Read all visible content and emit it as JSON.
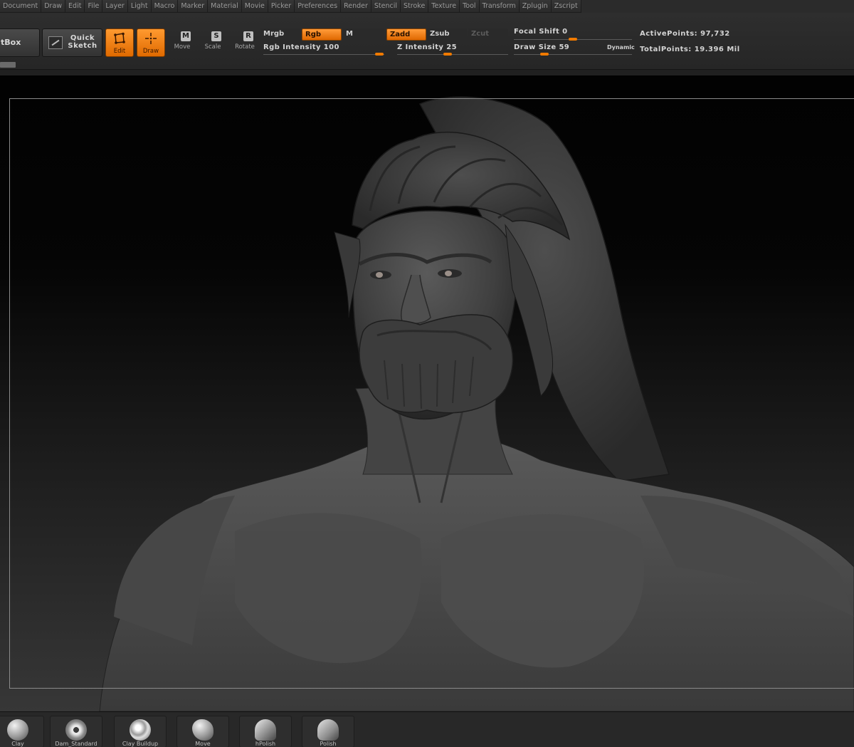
{
  "menu": [
    "Document",
    "Draw",
    "Edit",
    "File",
    "Layer",
    "Light",
    "Macro",
    "Marker",
    "Material",
    "Movie",
    "Picker",
    "Preferences",
    "Render",
    "Stencil",
    "Stroke",
    "Texture",
    "Tool",
    "Transform",
    "Zplugin",
    "Zscript"
  ],
  "toolbar": {
    "lightbox_label": "tBox",
    "quick_sketch_label": "Quick\nSketch",
    "edit_label": "Edit",
    "draw_label": "Draw",
    "move_label": "Move",
    "move_letter": "M",
    "scale_label": "Scale",
    "scale_letter": "S",
    "rotate_label": "Rotate",
    "rotate_letter": "R",
    "mrgb": "Mrgb",
    "rgb": "Rgb",
    "m": "M",
    "zadd": "Zadd",
    "zsub": "Zsub",
    "zcut": "Zcut",
    "rgb_intensity_label": "Rgb Intensity",
    "rgb_intensity_value": "100",
    "z_intensity_label": "Z Intensity",
    "z_intensity_value": "25",
    "focal_shift_label": "Focal Shift",
    "focal_shift_value": "0",
    "draw_size_label": "Draw Size",
    "draw_size_value": "59",
    "dynamic_label": "Dynamic",
    "active_points_label": "ActivePoints:",
    "active_points_value": "97,732",
    "total_points_label": "TotalPoints:",
    "total_points_value": "19.396 Mil"
  },
  "brushes": [
    {
      "label": "Clay",
      "icon": "clay-brush-icon"
    },
    {
      "label": "Dam_Standard",
      "icon": "dam-standard-brush-icon"
    },
    {
      "label": "Clay Buildup",
      "icon": "claybuildup-brush-icon"
    },
    {
      "label": "Move",
      "icon": "move-brush-icon"
    },
    {
      "label": "hPolish",
      "icon": "hpolish-brush-icon"
    },
    {
      "label": "Polish",
      "icon": "polish-brush-icon"
    }
  ],
  "colors": {
    "accent": "#f07a00",
    "background": "#1a1a1a"
  }
}
